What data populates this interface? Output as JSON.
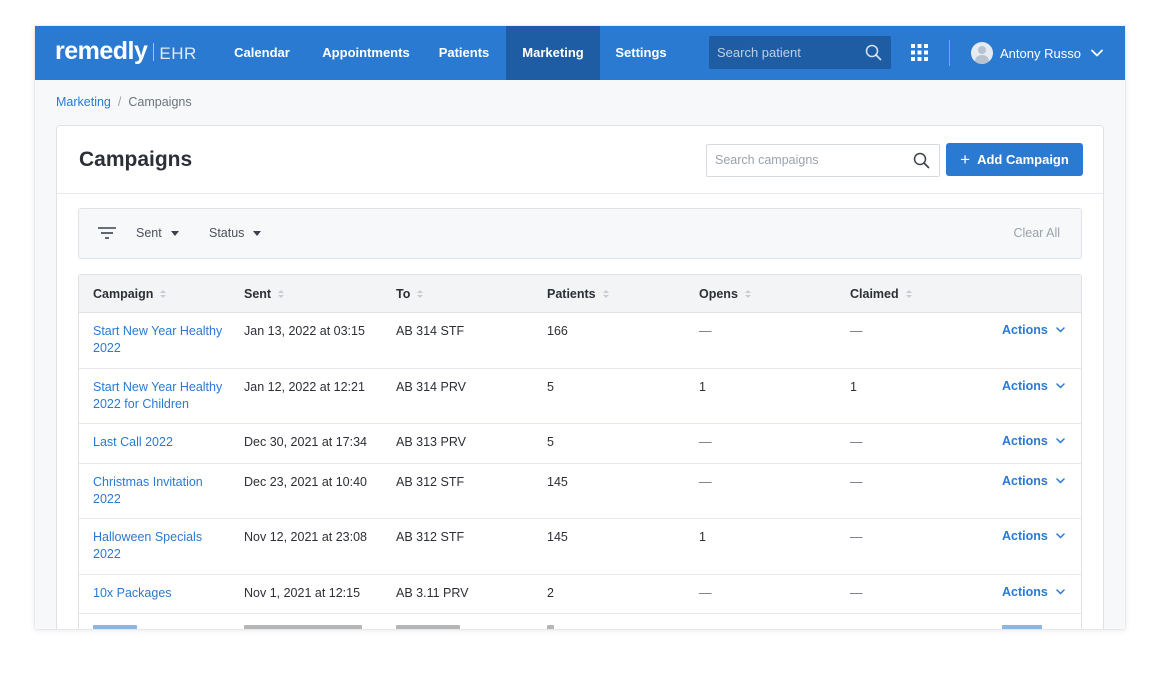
{
  "app": {
    "logo_main": "remedly",
    "logo_sub": "EHR",
    "accent": "#2a7ad2",
    "accent_dark": "#1e5da3"
  },
  "nav": {
    "items": [
      {
        "label": "Calendar",
        "active": false
      },
      {
        "label": "Appointments",
        "active": false
      },
      {
        "label": "Patients",
        "active": false
      },
      {
        "label": "Marketing",
        "active": true
      },
      {
        "label": "Settings",
        "active": false
      }
    ],
    "search_placeholder": "Search patient",
    "search_icon": "search-icon",
    "apps_icon": "apps-grid-icon",
    "user_name": "Antony Russo"
  },
  "breadcrumb": {
    "parent": "Marketing",
    "separator": "/",
    "current": "Campaigns"
  },
  "page": {
    "title": "Campaigns",
    "search_placeholder": "Search campaigns",
    "add_button": "Add Campaign"
  },
  "filters": {
    "items": [
      "Sent",
      "Status"
    ],
    "clear_all": "Clear All"
  },
  "table": {
    "columns": [
      "Campaign",
      "Sent",
      "To",
      "Patients",
      "Opens",
      "Claimed"
    ],
    "rows": [
      {
        "campaign_l1": "Start New Year Healthy",
        "campaign_l2": "2022",
        "sent": "Jan 13, 2022 at 03:15",
        "to": "AB 314 STF",
        "patients": "166",
        "opens": "—",
        "claimed": "—",
        "action": "Actions"
      },
      {
        "campaign_l1": "Start New Year Healthy",
        "campaign_l2": "2022 for Children",
        "sent": "Jan 12, 2022 at 12:21",
        "to": "AB 314 PRV",
        "patients": "5",
        "opens": "1",
        "claimed": "1",
        "action": "Actions"
      },
      {
        "campaign_l1": "Last Call 2022",
        "campaign_l2": "",
        "sent": "Dec 30, 2021 at 17:34",
        "to": "AB 313 PRV",
        "patients": "5",
        "opens": "—",
        "claimed": "—",
        "action": "Actions"
      },
      {
        "campaign_l1": "Christmas Invitation",
        "campaign_l2": "2022",
        "sent": "Dec 23, 2021 at 10:40",
        "to": "AB 312 STF",
        "patients": "145",
        "opens": "—",
        "claimed": "—",
        "action": "Actions"
      },
      {
        "campaign_l1": "Halloween Specials",
        "campaign_l2": "2022",
        "sent": "Nov 12, 2021 at 23:08",
        "to": "AB 312 STF",
        "patients": "145",
        "opens": "1",
        "claimed": "—",
        "action": "Actions"
      },
      {
        "campaign_l1": "10x Packages",
        "campaign_l2": "",
        "sent": "Nov 1, 2021 at 12:15",
        "to": "AB 3.11 PRV",
        "patients": "2",
        "opens": "—",
        "claimed": "—",
        "action": "Actions"
      }
    ]
  }
}
